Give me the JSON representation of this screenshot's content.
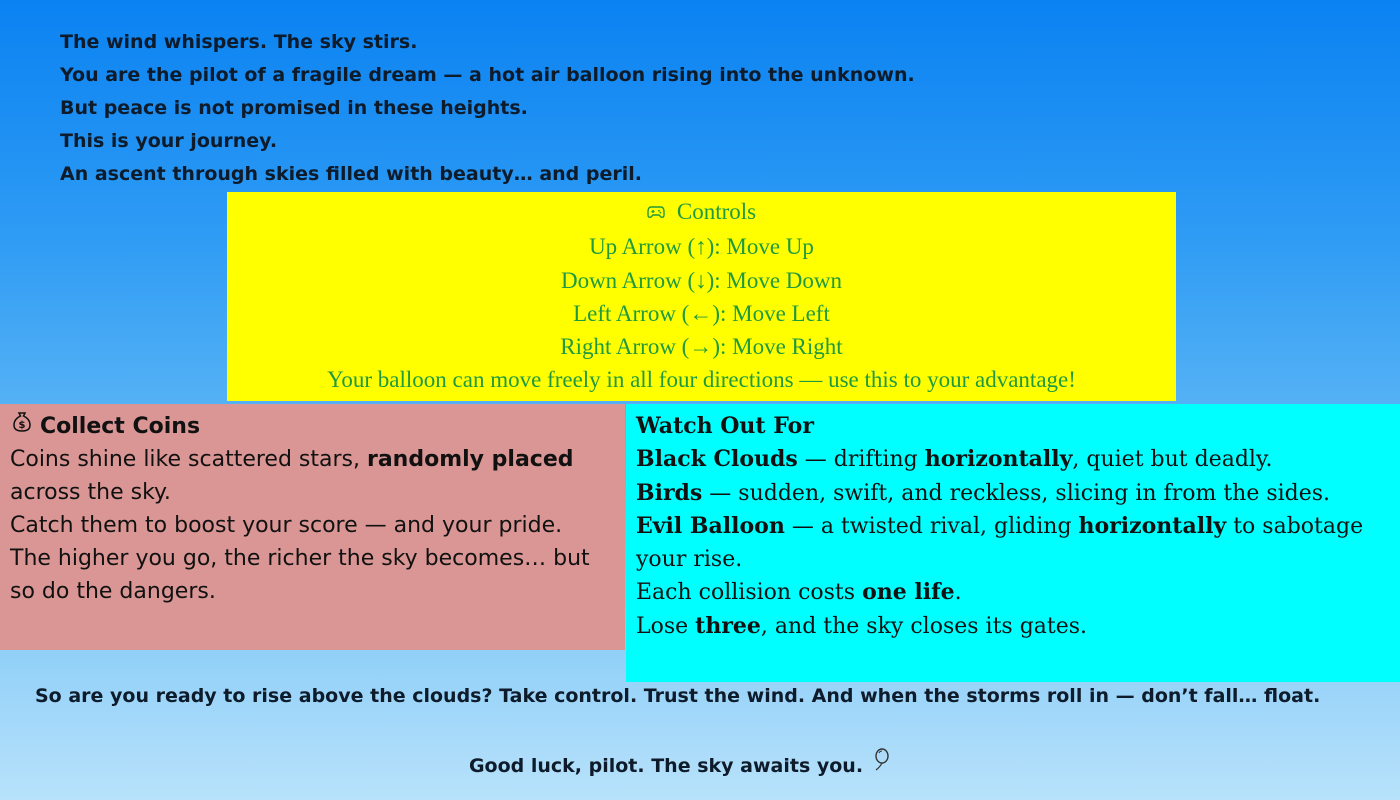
{
  "intro": {
    "lines": [
      "The wind whispers. The sky stirs.",
      "You are the pilot of a fragile dream — a hot air balloon rising into the unknown.",
      "But peace is not promised in these heights.",
      "This is your journey.",
      "An ascent through skies filled with beauty… and peril."
    ]
  },
  "controls": {
    "icon": "gamepad-icon",
    "title": "Controls",
    "up": "Up Arrow (↑): Move Up",
    "down": "Down Arrow (↓): Move Down",
    "left": "Left Arrow (←): Move Left",
    "right": "Right Arrow (→): Move Right",
    "note": "Your balloon can move freely in all four directions — use this to your advantage!"
  },
  "coins": {
    "icon": "money-bag-icon",
    "title": "Collect Coins",
    "p1_a": "Coins shine like scattered stars, ",
    "p1_b": "randomly placed",
    "p1_c": " across the sky.",
    "p2": "Catch them to boost your score — and your pride.",
    "p3": "The higher you go, the richer the sky becomes… but so do the dangers."
  },
  "watch": {
    "title": "Watch Out For",
    "clouds_name": "Black Clouds",
    "clouds_a": " — drifting ",
    "clouds_b": "horizontally",
    "clouds_c": ", quiet but deadly.",
    "birds_name": "Birds",
    "birds_text": " — sudden, swift, and reckless, slicing in from the sides.",
    "evil_name": "Evil Balloon",
    "evil_a": " — a twisted rival, gliding ",
    "evil_b": "horizontally",
    "evil_c": " to sabotage your rise.",
    "life_a": "Each collision costs ",
    "life_b": "one life",
    "life_c": ".",
    "lose_a": "Lose ",
    "lose_b": "three",
    "lose_c": ", and the sky closes its gates."
  },
  "outro": {
    "text": "So are you ready to rise above the clouds? Take control. Trust the wind. And when the storms roll in — don’t fall… float.",
    "farewell": "Good luck, pilot. The sky awaits you.",
    "farewell_icon": "balloon-icon"
  },
  "colors": {
    "sky_top": "#0a82f2",
    "controls_bg": "#ffff00",
    "controls_text": "#1f9a3e",
    "coins_bg": "#d99694",
    "watch_bg": "#00ffff"
  }
}
